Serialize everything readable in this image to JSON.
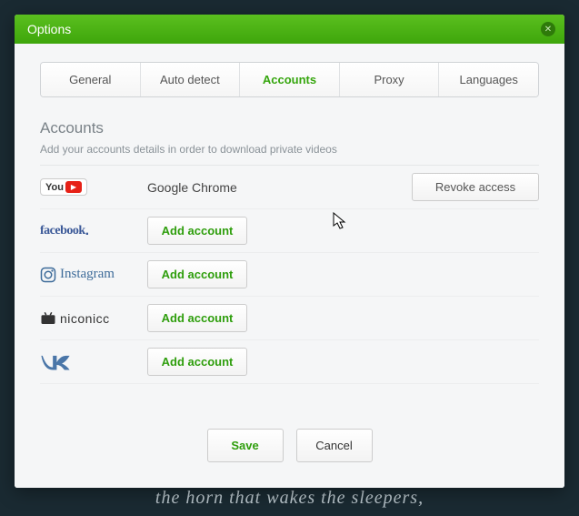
{
  "bg_caption": "the horn that wakes the sleepers,",
  "titlebar": {
    "title": "Options"
  },
  "tabs": {
    "items": [
      {
        "label": "General"
      },
      {
        "label": "Auto detect"
      },
      {
        "label": "Accounts"
      },
      {
        "label": "Proxy"
      },
      {
        "label": "Languages"
      }
    ],
    "active_index": 2
  },
  "section": {
    "heading": "Accounts",
    "description": "Add your accounts details in order to download private videos"
  },
  "accounts": {
    "youtube": {
      "name": "YouTube",
      "status": "Google Chrome",
      "action": "Revoke access"
    },
    "facebook": {
      "name": "facebook",
      "action": "Add account"
    },
    "instagram": {
      "name": "Instagram",
      "action": "Add account"
    },
    "niconico": {
      "name": "niconicc",
      "action": "Add account"
    },
    "vk": {
      "name": "VK",
      "action": "Add account"
    }
  },
  "footer": {
    "save": "Save",
    "cancel": "Cancel"
  }
}
